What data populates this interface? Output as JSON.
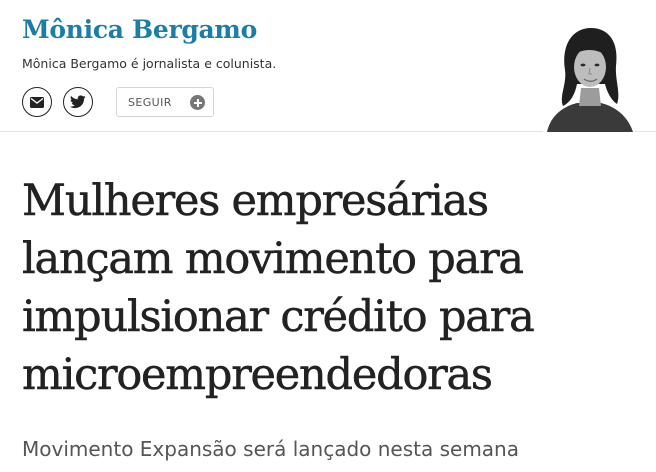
{
  "columnist": {
    "name": "Mônica Bergamo",
    "bio": "Mônica Bergamo é jornalista e colunista.",
    "avatar_alt": "Mônica Bergamo",
    "social": {
      "email_icon": "envelope-icon",
      "twitter_icon": "twitter-bird-icon"
    },
    "follow": {
      "label": "SEGUIR",
      "icon": "plus-circle-icon"
    }
  },
  "article": {
    "headline": "Mulheres empresárias lançam movimento para impulsionar crédito para microempreendedoras",
    "subtitle": "Movimento Expansão será lançado nesta semana"
  },
  "colors": {
    "brand": "#1c7ea6",
    "text": "#222222",
    "muted": "#555555",
    "divider": "#e3e3e3"
  }
}
